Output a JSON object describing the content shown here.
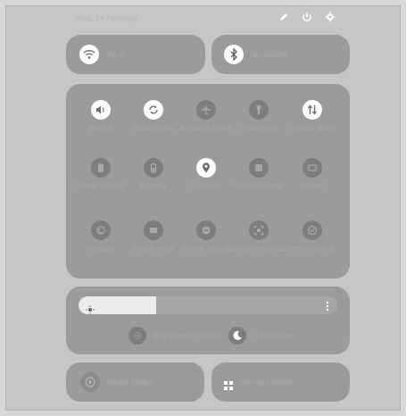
{
  "header": {
    "date_text": "Wed, 14 February",
    "icons": [
      "pencil-icon",
      "power-icon",
      "gear-icon"
    ]
  },
  "connectivity": {
    "wifi": {
      "label": "Wi-Fi",
      "state": "on"
    },
    "bluetooth": {
      "label": "Bluetooth",
      "state": "on"
    }
  },
  "quick_tiles": [
    {
      "name": "sound",
      "label": "Sound",
      "icon": "speaker-icon",
      "state": "on"
    },
    {
      "name": "auto-rotate",
      "label": "Auto rotate",
      "icon": "rotate-icon",
      "state": "on"
    },
    {
      "name": "airplane-mode",
      "label": "Airplane mode",
      "icon": "airplane-icon",
      "state": "off"
    },
    {
      "name": "flashlight",
      "label": "Flashlight",
      "icon": "flashlight-icon",
      "state": "off"
    },
    {
      "name": "mobile-data",
      "label": "Mobile data",
      "icon": "data-arrows-icon",
      "state": "on"
    },
    {
      "name": "battery-saver",
      "label": "Power saving",
      "icon": "battery-leaf-icon",
      "state": "off"
    },
    {
      "name": "battery",
      "label": "Battery",
      "icon": "battery-icon",
      "state": "off"
    },
    {
      "name": "location",
      "label": "Location",
      "icon": "location-pin-icon",
      "state": "on"
    },
    {
      "name": "secure-folder",
      "label": "Secure Folder",
      "icon": "folder-icon",
      "state": "off"
    },
    {
      "name": "screen-rotate",
      "label": "Screen",
      "icon": "screen-icon",
      "state": "off"
    },
    {
      "name": "hotspot",
      "label": "Hotspot",
      "icon": "hotspot-icon",
      "state": "off"
    },
    {
      "name": "smart-view",
      "label": "Smart View",
      "icon": "cast-icon",
      "state": "off"
    },
    {
      "name": "dnd",
      "label": "Do not disturb",
      "icon": "minus-circle-icon",
      "state": "off"
    },
    {
      "name": "screen-recorder",
      "label": "Screen recorder",
      "icon": "scan-icon",
      "state": "off"
    },
    {
      "name": "performance",
      "label": "Performance",
      "icon": "check-circle-icon",
      "state": "off"
    }
  ],
  "brightness": {
    "level": 0.3,
    "more_icon": "kebab-icon",
    "sun_icon": "sun-icon"
  },
  "display_modes": {
    "eye_comfort": {
      "label": "Eye comfort shield",
      "icon": "eye-comfort-icon"
    },
    "dark_mode": {
      "label": "Dark mode",
      "icon": "moon-icon"
    }
  },
  "bottom": {
    "media": {
      "label": "Media output",
      "icon": "play-icon"
    },
    "devices": {
      "label": "Device control",
      "icon": "grid-icon"
    }
  },
  "colors": {
    "panel": "#9b9b9b",
    "tile_on": "#ffffff",
    "tile_off": "#7e7e7e",
    "background": "#c6c6c6"
  }
}
